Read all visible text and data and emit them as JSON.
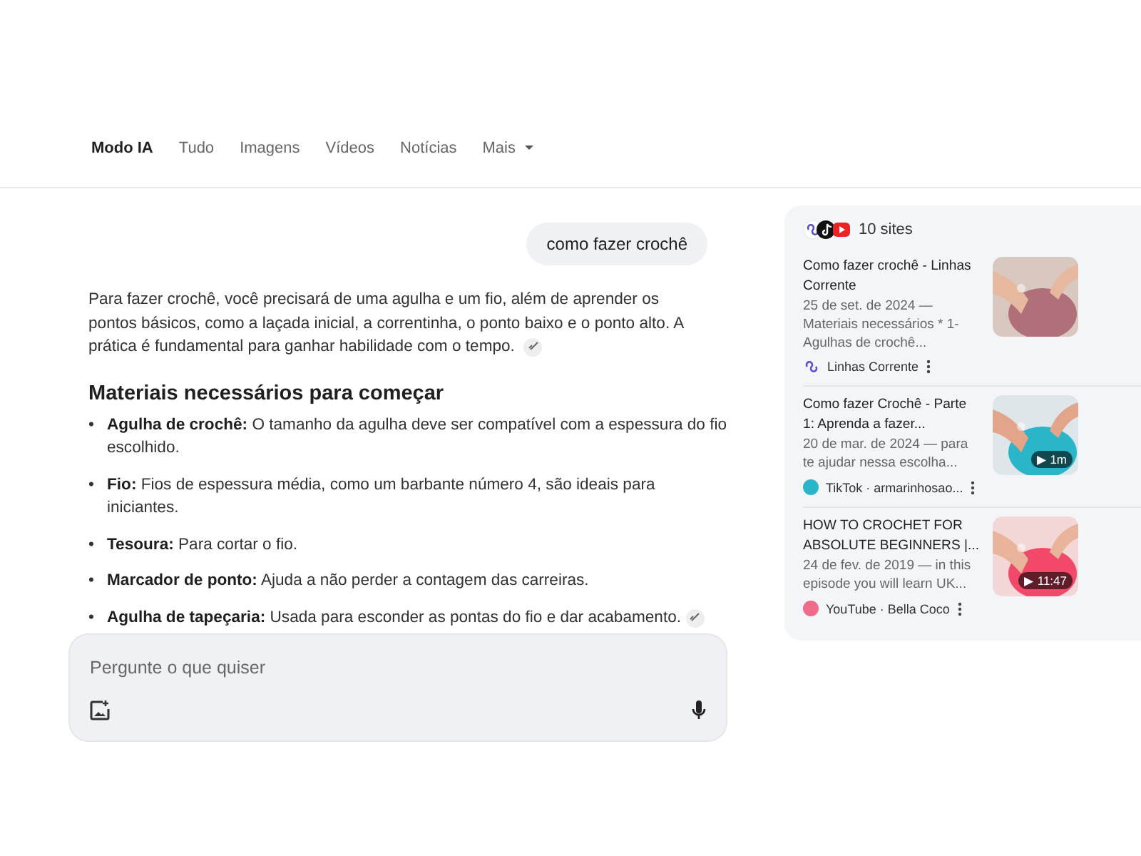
{
  "tabs": [
    {
      "label": "Modo IA",
      "selected": true
    },
    {
      "label": "Tudo",
      "selected": false
    },
    {
      "label": "Imagens",
      "selected": false
    },
    {
      "label": "Vídeos",
      "selected": false
    },
    {
      "label": "Notícias",
      "selected": false
    },
    {
      "label": "Mais",
      "selected": false,
      "kind": "menu"
    }
  ],
  "query": "como fazer crochê",
  "intro": "Para fazer crochê, você precisará de uma agulha e um fio, além de aprender os pontos básicos, como a laçada inicial, a correntinha, o ponto baixo e o ponto alto. A prática é fundamental para ganhar habilidade com o tempo.",
  "heading": "Materiais necessários para começar",
  "bullets": [
    {
      "marker": "•",
      "text": "**Agulha de crochê:** O tamanho da agulha deve ser compatível com a espessura do fio escolhido."
    },
    {
      "marker": "•",
      "text": "**Fio:** Fios de espessura média, como um barbante número 4, são ideais para iniciantes."
    },
    {
      "marker": "•",
      "text": "**Tesoura:** Para cortar o fio."
    },
    {
      "marker": "•",
      "text": "**Marcador de ponto:** Ajuda a não perder a contagem das carreiras."
    },
    {
      "marker": "•",
      "text": "**Agulha de tapeçaria:** Usada para esconder as pontas do fio e dar acabamento.",
      "link": true
    }
  ],
  "prompt": {
    "placeholder": "Pergunte o que quiser"
  },
  "sources": {
    "count": "10 sites",
    "items": [
      {
        "title": "Como fazer crochê - Linhas Corrente",
        "snippet": "25 de set. de 2024 — Materiais necessários * 1- Agulhas de crochê...",
        "site": "Linhas Corrente",
        "kind": "logo"
      },
      {
        "title": "Como fazer Crochê - Parte 1: Aprenda a fazer...",
        "snippet": "20 de mar. de 2024 — para te ajudar nessa escolha...",
        "site": "TikTok · armarinhosao...",
        "kind": "avatar",
        "color": "#2bb5c9",
        "duration": "▶ 1m"
      },
      {
        "title": "HOW TO CROCHET FOR ABSOLUTE BEGINNERS |...",
        "snippet": "24 de fev. de 2019 — in this episode you will learn UK...",
        "site": "YouTube · Bella Coco",
        "kind": "avatar",
        "color": "#f06a8a",
        "duration": "▶ 11:47"
      }
    ]
  }
}
